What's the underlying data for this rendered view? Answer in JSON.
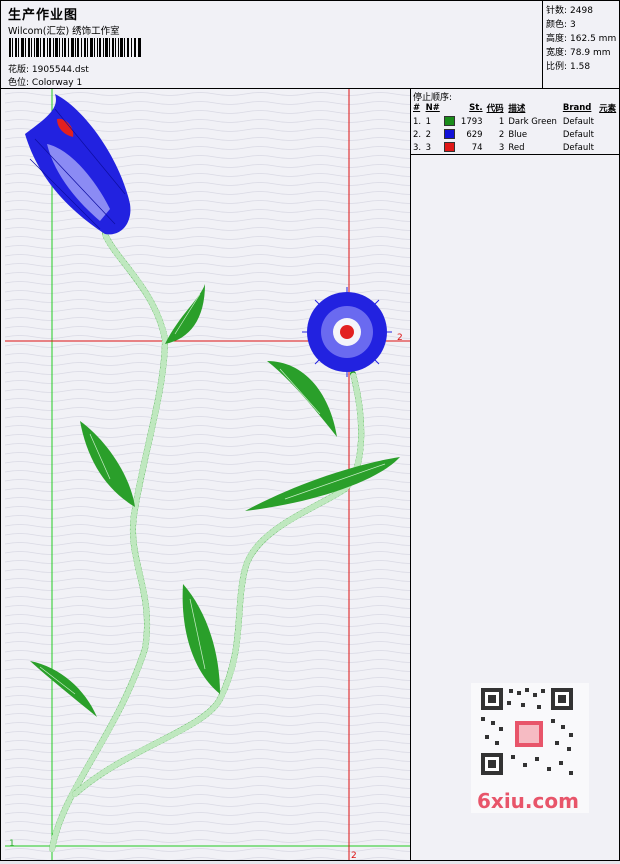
{
  "header": {
    "title": "生产作业图",
    "company": "Wilcom(汇宏) 绣饰工作室",
    "design_label": "花版:",
    "design_file": "1905544.dst",
    "colorway_label": "色位:",
    "colorway": "Colorway 1"
  },
  "stats": [
    {
      "label": "针数:",
      "value": "2498"
    },
    {
      "label": "颜色:",
      "value": "3"
    },
    {
      "label": "高度:",
      "value": "162.5 mm"
    },
    {
      "label": "宽度:",
      "value": "78.9 mm"
    },
    {
      "label": "比例:",
      "value": "1.58"
    }
  ],
  "panel": {
    "title": "停止顺序:",
    "columns": [
      "#",
      "N#",
      "St.",
      "代码",
      "描述",
      "Brand",
      "元素"
    ],
    "rows": [
      {
        "idx": "1.",
        "n": "1",
        "color": "#1a8c1a",
        "st": "1793",
        "code": "1",
        "desc": "Dark Green",
        "brand": "Default"
      },
      {
        "idx": "2.",
        "n": "2",
        "color": "#1212d8",
        "st": "629",
        "code": "2",
        "desc": "Blue",
        "brand": "Default"
      },
      {
        "idx": "3.",
        "n": "3",
        "color": "#e01818",
        "st": "74",
        "code": "3",
        "desc": "Red",
        "brand": "Default"
      }
    ]
  },
  "markers": {
    "left_bottom": "1",
    "bottom_right": "2",
    "right_mid": "2"
  },
  "watermark": {
    "text": "6xiu.com"
  },
  "colors": {
    "green": "#1f9a1f",
    "blue": "#1c1ce0",
    "red": "#e22020",
    "guide_green": "#22cc22",
    "guide_red": "#dd1111"
  }
}
